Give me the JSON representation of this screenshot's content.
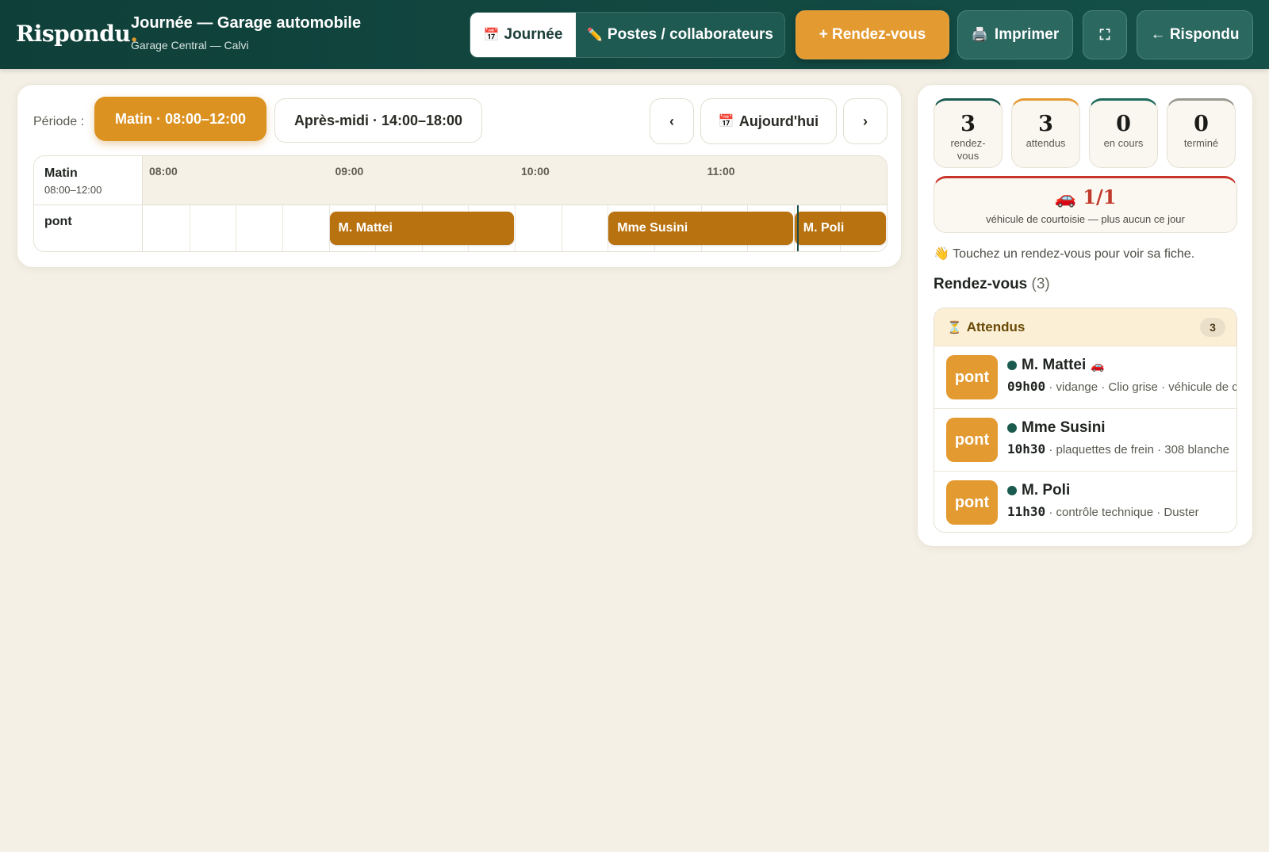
{
  "header": {
    "brand": "Rispondu",
    "brand_dot": ".",
    "title": "Journée — Garage automobile",
    "subtitle": "Garage Central — Calvi",
    "tabs": [
      {
        "icon": "calendar-icon",
        "glyph": "📅",
        "label": "Journée"
      },
      {
        "icon": "pencil-icon",
        "glyph": "✏️",
        "label": "Postes / collaborateurs"
      }
    ],
    "new_label": "+ Rendez-vous",
    "print_glyph": "🖨️",
    "print_label": "Imprimer",
    "fullscreen_glyph": "⛶",
    "back_label": "← Rispondu"
  },
  "planning": {
    "periode_label": "Période :",
    "periods": [
      "Matin · 08:00–12:00",
      "Après-midi · 14:00–18:00"
    ],
    "active_period": 0,
    "prev_label": "‹",
    "next_label": "›",
    "today_glyph": "📅",
    "today_label": "Aujourd'hui",
    "grid": {
      "period_name": "Matin",
      "period_range": "08:00–12:00",
      "ticks": [
        "08:00",
        "09:00",
        "10:00",
        "11:00"
      ],
      "lane_label": "pont",
      "appointments": [
        {
          "name": "M. Mattei",
          "start": "09:00",
          "end": "10:00"
        },
        {
          "name": "Mme Susini",
          "start": "10:30",
          "end": "11:30"
        },
        {
          "name": "M. Poli",
          "start": "11:30",
          "end": "12:00"
        }
      ],
      "now": "11:31"
    }
  },
  "stats": [
    {
      "value": "3",
      "label": "rendez-vous",
      "accent": "#1b5a4f"
    },
    {
      "value": "3",
      "label": "attendus",
      "accent": "#e39a30"
    },
    {
      "value": "0",
      "label": "en cours",
      "accent": "#1b6a5a"
    },
    {
      "value": "0",
      "label": "terminé",
      "accent": "#9a9a92"
    }
  ],
  "courtesy": {
    "glyph": "🚗",
    "value": "1/1",
    "label": "véhicule de courtoisie — plus aucun ce jour"
  },
  "hint": {
    "glyph": "👋",
    "text": "Touchez un rendez-vous pour voir sa fiche."
  },
  "list": {
    "title": "Rendez-vous",
    "count": "(3)",
    "group": {
      "glyph": "⏳",
      "label": "Attendus",
      "count": "3"
    },
    "items": [
      {
        "chip": "pont",
        "name": "M. Mattei",
        "car_glyph": "🚗",
        "time": "09h00",
        "detail": " · vidange · Clio grise · véhicule de courtoisie"
      },
      {
        "chip": "pont",
        "name": "Mme Susini",
        "car_glyph": "",
        "time": "10h30",
        "detail": " · plaquettes de frein · 308 blanche"
      },
      {
        "chip": "pont",
        "name": "M. Poli",
        "car_glyph": "",
        "time": "11h30",
        "detail": " · contrôle technique · Duster"
      }
    ]
  },
  "colors": {
    "topbar": "#145048",
    "accent": "#e39a30",
    "appointment": "#b8720f",
    "alert": "#c0392b"
  }
}
